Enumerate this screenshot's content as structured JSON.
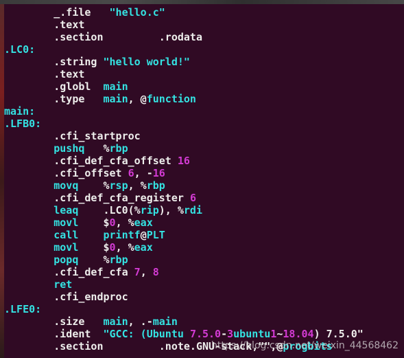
{
  "terminal": {
    "lines": [
      {
        "indent": "        ",
        "tokens": [
          {
            "t": "_.file   ",
            "c": "wh"
          },
          {
            "t": "\"hello.c\"",
            "c": "cy"
          }
        ]
      },
      {
        "indent": "        ",
        "tokens": [
          {
            "t": ".text",
            "c": "wh"
          }
        ]
      },
      {
        "indent": "        ",
        "tokens": [
          {
            "t": ".section         .rodata",
            "c": "wh"
          }
        ]
      },
      {
        "indent": "",
        "tokens": [
          {
            "t": ".LC0:",
            "c": "cy"
          }
        ]
      },
      {
        "indent": "        ",
        "tokens": [
          {
            "t": ".string ",
            "c": "wh"
          },
          {
            "t": "\"hello world!\"",
            "c": "cy"
          }
        ]
      },
      {
        "indent": "        ",
        "tokens": [
          {
            "t": ".text",
            "c": "wh"
          }
        ]
      },
      {
        "indent": "        ",
        "tokens": [
          {
            "t": ".globl  ",
            "c": "wh"
          },
          {
            "t": "main",
            "c": "cy"
          }
        ]
      },
      {
        "indent": "        ",
        "tokens": [
          {
            "t": ".type   ",
            "c": "wh"
          },
          {
            "t": "main",
            "c": "cy"
          },
          {
            "t": ", @",
            "c": "wh"
          },
          {
            "t": "function",
            "c": "cy"
          }
        ]
      },
      {
        "indent": "",
        "tokens": [
          {
            "t": "main:",
            "c": "cy"
          }
        ]
      },
      {
        "indent": "",
        "tokens": [
          {
            "t": ".LFB0:",
            "c": "cy"
          }
        ]
      },
      {
        "indent": "        ",
        "tokens": [
          {
            "t": ".cfi_startproc",
            "c": "wh"
          }
        ]
      },
      {
        "indent": "        ",
        "tokens": [
          {
            "t": "pushq   ",
            "c": "cy"
          },
          {
            "t": "%",
            "c": "wh"
          },
          {
            "t": "rbp",
            "c": "cy"
          }
        ]
      },
      {
        "indent": "        ",
        "tokens": [
          {
            "t": ".cfi_def_cfa_offset ",
            "c": "wh"
          },
          {
            "t": "16",
            "c": "mg"
          }
        ]
      },
      {
        "indent": "        ",
        "tokens": [
          {
            "t": ".cfi_offset ",
            "c": "wh"
          },
          {
            "t": "6",
            "c": "mg"
          },
          {
            "t": ", -",
            "c": "wh"
          },
          {
            "t": "16",
            "c": "mg"
          }
        ]
      },
      {
        "indent": "        ",
        "tokens": [
          {
            "t": "movq    ",
            "c": "cy"
          },
          {
            "t": "%",
            "c": "wh"
          },
          {
            "t": "rsp",
            "c": "cy"
          },
          {
            "t": ", %",
            "c": "wh"
          },
          {
            "t": "rbp",
            "c": "cy"
          }
        ]
      },
      {
        "indent": "        ",
        "tokens": [
          {
            "t": ".cfi_def_cfa_register ",
            "c": "wh"
          },
          {
            "t": "6",
            "c": "mg"
          }
        ]
      },
      {
        "indent": "        ",
        "tokens": [
          {
            "t": "leaq    ",
            "c": "cy"
          },
          {
            "t": ".LC0(%",
            "c": "wh"
          },
          {
            "t": "rip",
            "c": "cy"
          },
          {
            "t": "), %",
            "c": "wh"
          },
          {
            "t": "rdi",
            "c": "cy"
          }
        ]
      },
      {
        "indent": "        ",
        "tokens": [
          {
            "t": "movl    ",
            "c": "cy"
          },
          {
            "t": "$",
            "c": "wh"
          },
          {
            "t": "0",
            "c": "mg"
          },
          {
            "t": ", %",
            "c": "wh"
          },
          {
            "t": "eax",
            "c": "cy"
          }
        ]
      },
      {
        "indent": "        ",
        "tokens": [
          {
            "t": "call    ",
            "c": "cy"
          },
          {
            "t": "printf",
            "c": "cy"
          },
          {
            "t": "@",
            "c": "wh"
          },
          {
            "t": "PLT",
            "c": "cy"
          }
        ]
      },
      {
        "indent": "        ",
        "tokens": [
          {
            "t": "movl    ",
            "c": "cy"
          },
          {
            "t": "$",
            "c": "wh"
          },
          {
            "t": "0",
            "c": "mg"
          },
          {
            "t": ", %",
            "c": "wh"
          },
          {
            "t": "eax",
            "c": "cy"
          }
        ]
      },
      {
        "indent": "        ",
        "tokens": [
          {
            "t": "popq    ",
            "c": "cy"
          },
          {
            "t": "%",
            "c": "wh"
          },
          {
            "t": "rbp",
            "c": "cy"
          }
        ]
      },
      {
        "indent": "        ",
        "tokens": [
          {
            "t": ".cfi_def_cfa ",
            "c": "wh"
          },
          {
            "t": "7",
            "c": "mg"
          },
          {
            "t": ", ",
            "c": "wh"
          },
          {
            "t": "8",
            "c": "mg"
          }
        ]
      },
      {
        "indent": "        ",
        "tokens": [
          {
            "t": "ret",
            "c": "cy"
          }
        ]
      },
      {
        "indent": "        ",
        "tokens": [
          {
            "t": ".cfi_endproc",
            "c": "wh"
          }
        ]
      },
      {
        "indent": "",
        "tokens": [
          {
            "t": ".LFE0:",
            "c": "cy"
          }
        ]
      },
      {
        "indent": "        ",
        "tokens": [
          {
            "t": ".size   ",
            "c": "wh"
          },
          {
            "t": "main",
            "c": "cy"
          },
          {
            "t": ", .-",
            "c": "wh"
          },
          {
            "t": "main",
            "c": "cy"
          }
        ]
      },
      {
        "indent": "        ",
        "tokens": [
          {
            "t": ".ident  ",
            "c": "wh"
          },
          {
            "t": "\"GCC: (Ubuntu ",
            "c": "cy"
          },
          {
            "t": "7.5.0",
            "c": "mg"
          },
          {
            "t": "-",
            "c": "wh"
          },
          {
            "t": "3",
            "c": "mg"
          },
          {
            "t": "ubuntu",
            "c": "cy"
          },
          {
            "t": "1",
            "c": "mg"
          },
          {
            "t": "~",
            "c": "wh"
          },
          {
            "t": "18.04",
            "c": "mg"
          },
          {
            "t": ") 7.5.0\"",
            "c": "wh"
          }
        ]
      },
      {
        "indent": "        ",
        "tokens": [
          {
            "t": ".section         .note.GNU-stack,\"\",@",
            "c": "wh"
          },
          {
            "t": "progbits",
            "c": "cy"
          }
        ]
      }
    ],
    "watermark": "https://blog.csdn.net/weixin_44568462"
  },
  "colors": {
    "background": "#300a24",
    "cyan": "#34e2e2",
    "white": "#eeeeec",
    "magenta": "#d33bd3"
  }
}
